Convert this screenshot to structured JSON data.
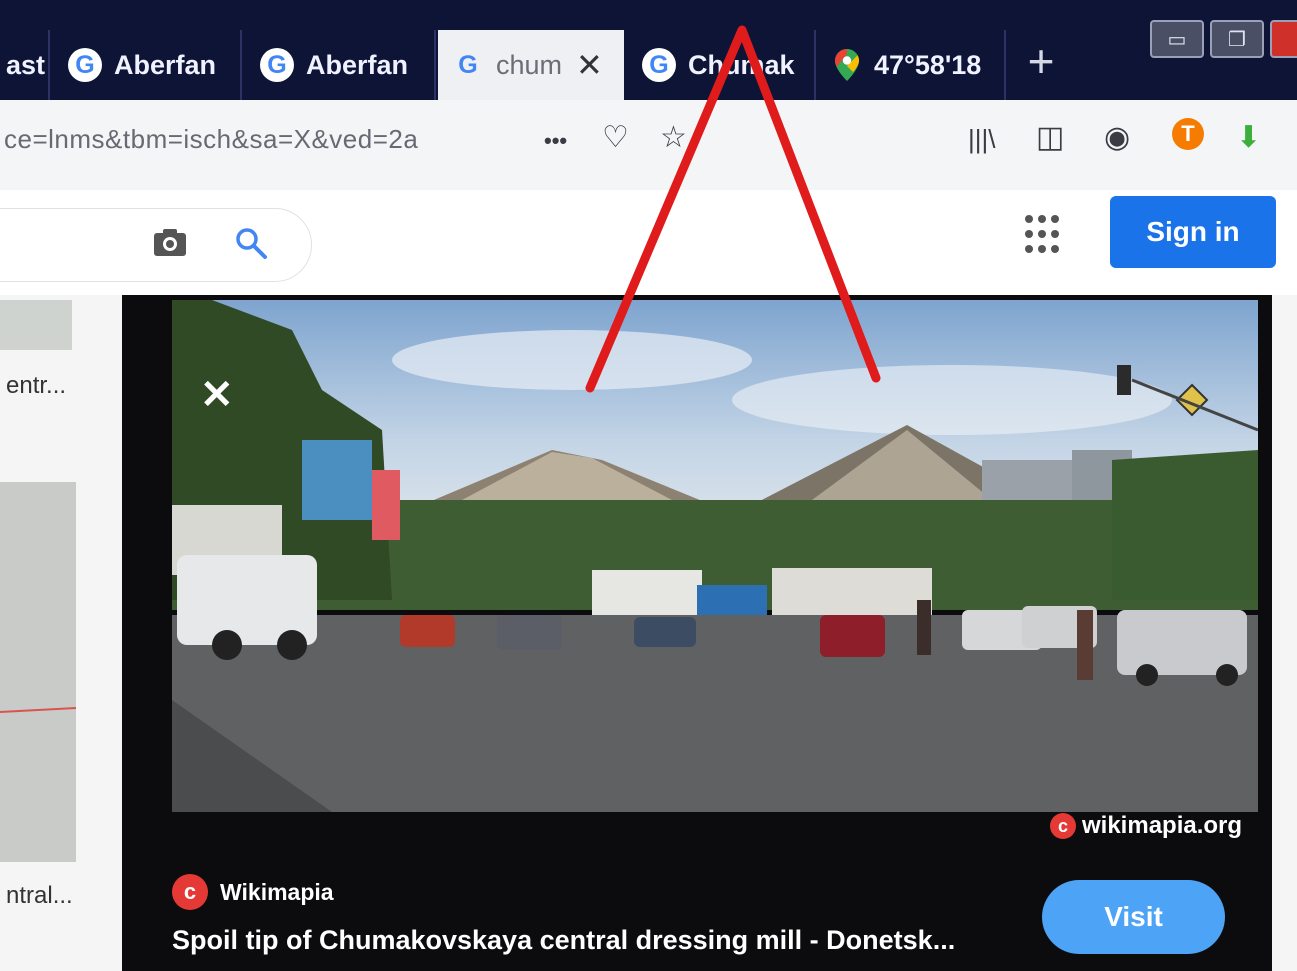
{
  "tabs": [
    {
      "title": "ast",
      "icon": "none"
    },
    {
      "title": "Aberfan",
      "icon": "google-icon"
    },
    {
      "title": "Aberfan",
      "icon": "google-icon"
    },
    {
      "title": "chum",
      "icon": "google-icon",
      "active": true,
      "close": "✕"
    },
    {
      "title": "Chumak",
      "icon": "google-icon"
    },
    {
      "title": "47°58'18",
      "icon": "map-pin-icon"
    }
  ],
  "newtab_label": "+",
  "window_controls": {
    "minimize": "▭",
    "restore": "❐"
  },
  "url": {
    "text": "ce=lnms&tbm=isch&sa=X&ved=2a"
  },
  "nav": {
    "more": "•••",
    "pocket": "♡",
    "bookmark": "☆",
    "library": "|||\\",
    "sidebar": "◫",
    "account": "◉",
    "addon": "T",
    "download": "⬇"
  },
  "search": {
    "camera": "📷",
    "search": "🔍"
  },
  "signin_label": "Sign in",
  "left_results": [
    {
      "label": "entr..."
    },
    {
      "label": "ntral..."
    }
  ],
  "viewer": {
    "close": "✕",
    "credit": "wikimapia.org",
    "source_name": "Wikimapia",
    "caption": "Spoil tip of Chumakovskaya central dressing mill - Donetsk...",
    "visit_label": "Visit"
  },
  "colors": {
    "accent": "#1a73e8",
    "tabbar": "#0d1436",
    "annotation": "#e01b1b"
  }
}
